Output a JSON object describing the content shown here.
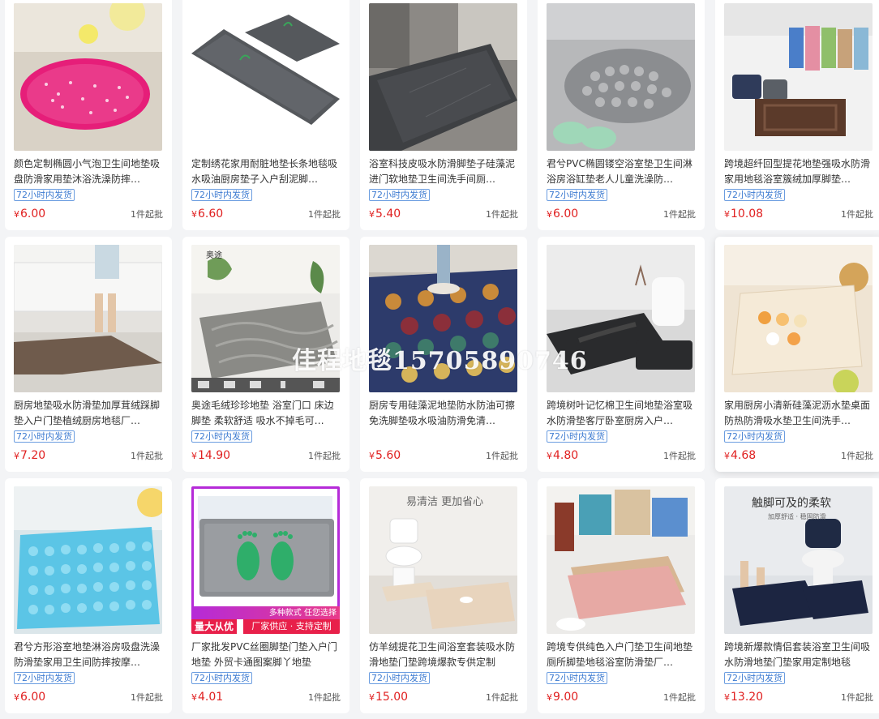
{
  "watermark": "佳程地毯15705890746",
  "tag_label": "72小时内发货",
  "min_order_label": "1件起批",
  "currency": "¥",
  "products": [
    {
      "title": "颜色定制椭圆小气泡卫生间地垫吸盘防滑家用垫沐浴洗澡防摔…",
      "price": "6.00",
      "has_tag": true
    },
    {
      "title": "定制绣花家用耐脏地垫长条地毯吸水吸油厨房垫子入户刮泥脚…",
      "price": "6.60",
      "has_tag": true
    },
    {
      "title": "浴室科技皮吸水防滑脚垫子硅藻泥进门软地垫卫生间洗手间厕…",
      "price": "5.40",
      "has_tag": true
    },
    {
      "title": "君兮PVC椭圆镂空浴室垫卫生间淋浴房浴缸垫老人儿童洗澡防…",
      "price": "6.00",
      "has_tag": true
    },
    {
      "title": "跨境超纤回型提花地垫强吸水防滑家用地毯浴室簇绒加厚脚垫…",
      "price": "10.08",
      "has_tag": true
    },
    {
      "title": "厨房地垫吸水防滑垫加厚茸绒踩脚垫入户门垫植绒厨房地毯厂…",
      "price": "7.20",
      "has_tag": true
    },
    {
      "title": "奥途毛绒珍珍地垫 浴室门口 床边脚垫 柔软舒适 吸水不掉毛可…",
      "price": "14.90",
      "has_tag": true
    },
    {
      "title": "厨房专用硅藻泥地垫防水防油可擦免洗脚垫吸水吸油防滑免清…",
      "price": "5.60",
      "has_tag": false
    },
    {
      "title": "跨境树叶记忆棉卫生间地垫浴室吸水防滑垫客厅卧室厨房入户…",
      "price": "4.80",
      "has_tag": true
    },
    {
      "title": "家用厨房小清新硅藻泥沥水垫桌面防热防滑吸水垫卫生间洗手…",
      "price": "4.68",
      "has_tag": true
    },
    {
      "title": "君兮方形浴室地垫淋浴房吸盘洗澡防滑垫家用卫生间防摔按摩…",
      "price": "6.00",
      "has_tag": true
    },
    {
      "title": "厂家批发PVC丝圈脚垫门垫入户门地垫 外贸卡通图案脚丫地垫",
      "price": "4.01",
      "has_tag": true
    },
    {
      "title": "仿羊绒提花卫生间浴室套装吸水防滑地垫门垫跨境爆款专供定制",
      "price": "15.00",
      "has_tag": true
    },
    {
      "title": "跨境专供纯色入户门垫卫生间地垫厕所脚垫地毯浴室防滑垫厂…",
      "price": "9.00",
      "has_tag": true
    },
    {
      "title": "跨境新爆款情侣套装浴室卫生间吸水防滑地垫门垫家用定制地毯",
      "price": "13.20",
      "has_tag": true
    }
  ],
  "image_texts": {
    "brand_logo": "奥途",
    "promo_top": "多种款式 任您选择",
    "promo_left": "量大从优",
    "promo_right": "厂家供应 · 支持定制",
    "slogan_13": "易清洁 更加省心",
    "slogan_15": "触脚可及的柔软",
    "slogan_15_sub": "加厚舒适 · 稳固防滑"
  }
}
